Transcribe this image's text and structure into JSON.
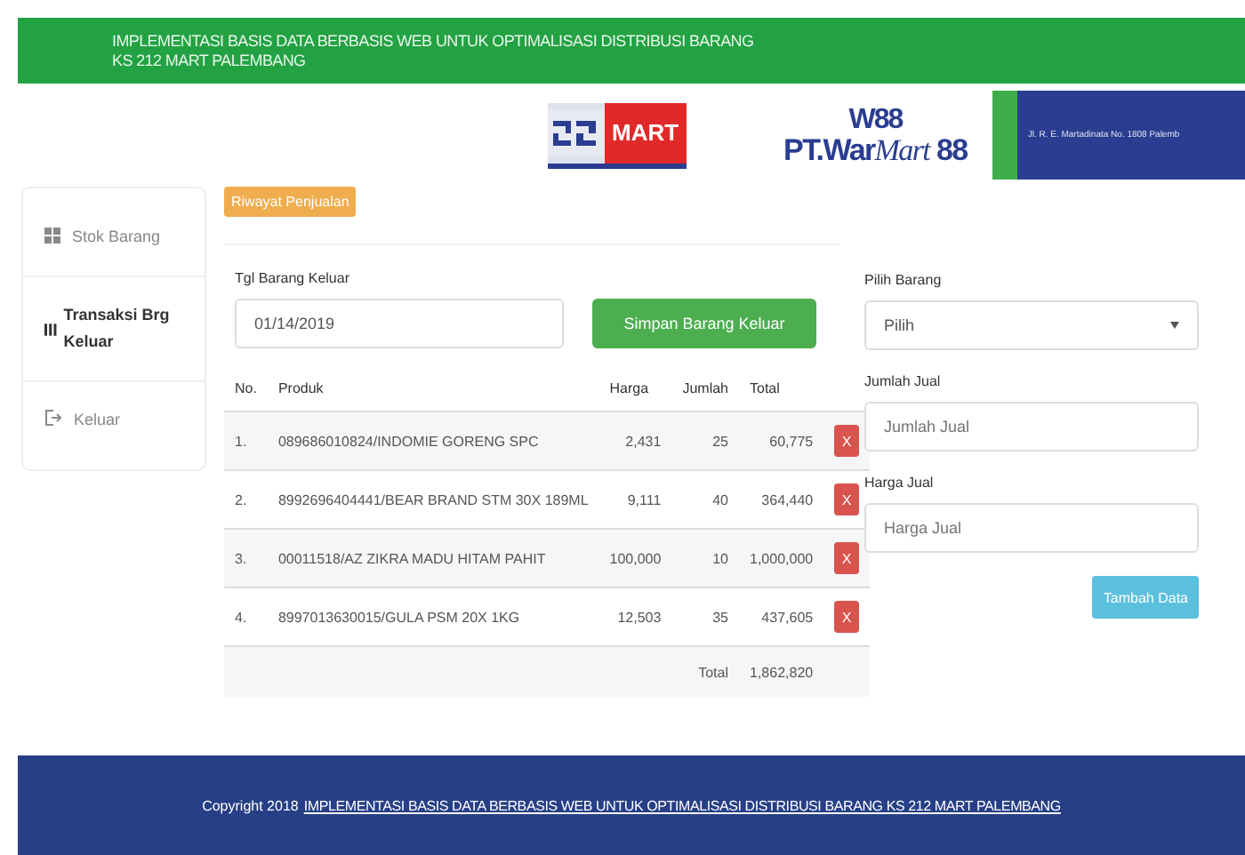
{
  "header": {
    "title_lines": [
      "IMPLEMENTASI BASIS DATA BERBASIS WEB UNTUK OPTIMALISASI DISTRIBUSI BARANG",
      "KS 212 MART PALEMBANG"
    ]
  },
  "logos": {
    "mart_label": "MART",
    "warmart_mark": "W88",
    "warmart_name": "PT.War",
    "warmart_script": "Mart",
    "warmart_number": "88",
    "address": "Jl. R. E. Martadinata No. 1808 Palemb"
  },
  "sidebar": {
    "items": [
      {
        "label": "Stok Barang",
        "kind": "grid",
        "selected": false
      },
      {
        "label": "Transaksi Brg Keluar",
        "kind": "bars",
        "selected": true
      },
      {
        "label": "Keluar",
        "kind": "logout",
        "selected": false
      }
    ]
  },
  "history_button": "Riwayat Penjualan",
  "date_field": {
    "label": "Tgl Barang Keluar",
    "value": "01/14/2019"
  },
  "save_button": "Simpan Barang Keluar",
  "table": {
    "columns": [
      "No.",
      "Produk",
      "Harga",
      "Jumlah",
      "Total"
    ],
    "rows": [
      {
        "no": "1.",
        "product": "089686010824/INDOMIE GORENG SPC",
        "price": "2,431",
        "qty": "25",
        "total": "60,775",
        "delete": "X"
      },
      {
        "no": "2.",
        "product": "8992696404441/BEAR BRAND STM 30X 189ML",
        "price": "9,111",
        "qty": "40",
        "total": "364,440",
        "delete": "X"
      },
      {
        "no": "3.",
        "product": "00011518/AZ ZIKRA MADU HITAM PAHIT",
        "price": "100,000",
        "qty": "10",
        "total": "1,000,000",
        "delete": "X"
      },
      {
        "no": "4.",
        "product": "8997013630015/GULA PSM 20X 1KG",
        "price": "12,503",
        "qty": "35",
        "total": "437,605",
        "delete": "X"
      }
    ],
    "footer": {
      "label": "Total",
      "value": "1,862,820"
    }
  },
  "form": {
    "product_select": {
      "label": "Pilih Barang",
      "value": "Pilih"
    },
    "qty_field": {
      "label": "Jumlah Jual",
      "placeholder": "Jumlah Jual"
    },
    "price_field": {
      "label": "Harga Jual",
      "placeholder": "Harga Jual"
    },
    "add_button": "Tambah Data"
  },
  "footer": {
    "prefix": "Copyright 2018",
    "link": "IMPLEMENTASI BASIS DATA BERBASIS WEB UNTUK OPTIMALISASI DISTRIBUSI BARANG KS 212 MART PALEMBANG"
  }
}
